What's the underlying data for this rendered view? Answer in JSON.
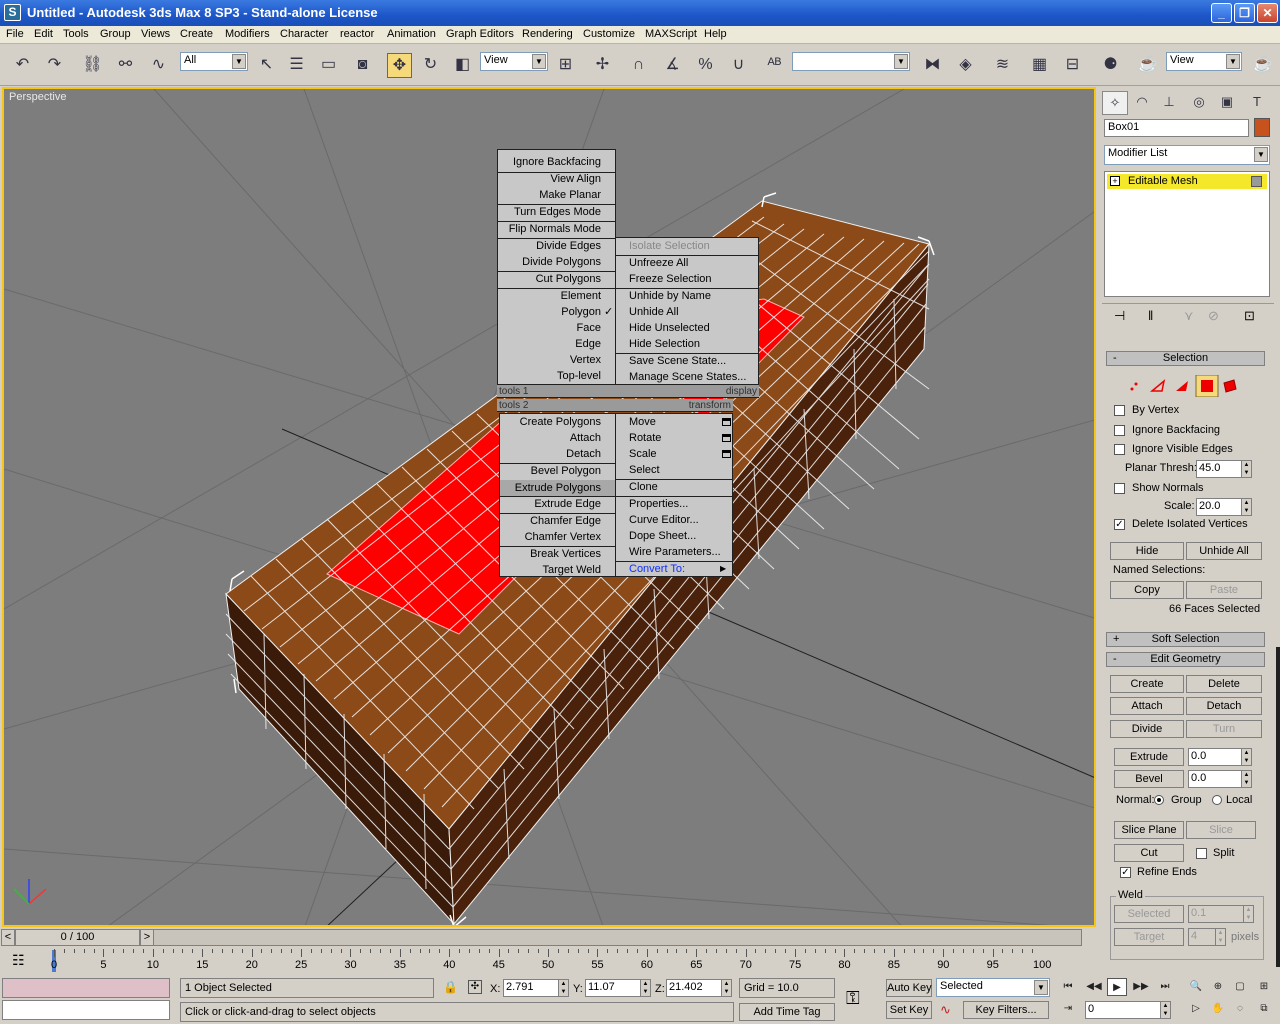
{
  "window": {
    "title": "Untitled - Autodesk 3ds Max 8 SP3   - Stand-alone License",
    "icon": "3ds-max-icon",
    "min": "_",
    "max": "❐",
    "close": "✕"
  },
  "menu": [
    "File",
    "Edit",
    "Tools",
    "Group",
    "Views",
    "Create",
    "Modifiers",
    "Character",
    "reactor",
    "Animation",
    "Graph Editors",
    "Rendering",
    "Customize",
    "MAXScript",
    "Help"
  ],
  "toolbar": {
    "selection_filter": "All",
    "ref_coord_left": "View",
    "named_selection": "",
    "ref_coord_right": "View"
  },
  "viewport": {
    "label": "Perspective"
  },
  "quad": {
    "tools1_header": "tools 1",
    "display_header": "display",
    "tools2_header": "tools 2",
    "transform_header": "transform",
    "tools1": [
      "Ignore Backfacing",
      "View Align",
      "Make Planar",
      "Turn Edges Mode",
      "Flip Normals Mode",
      "Divide Edges",
      "Divide Polygons",
      "Cut Polygons",
      "Element",
      "Polygon",
      "Face",
      "Edge",
      "Vertex",
      "Top-level"
    ],
    "display": [
      "Isolate Selection",
      "Unfreeze All",
      "Freeze Selection",
      "Unhide by Name",
      "Unhide All",
      "Hide Unselected",
      "Hide Selection",
      "Save Scene State...",
      "Manage Scene States..."
    ],
    "tools2": [
      "Create Polygons",
      "Attach",
      "Detach",
      "Bevel Polygon",
      "Extrude Polygons",
      "Extrude Edge",
      "Chamfer Edge",
      "Chamfer Vertex",
      "Break Vertices",
      "Target Weld"
    ],
    "transform": [
      "Move",
      "Rotate",
      "Scale",
      "Select",
      "Clone",
      "Properties...",
      "Curve Editor...",
      "Dope Sheet...",
      "Wire Parameters...",
      "Convert To:"
    ],
    "checkmark": "✓",
    "submenu_arrow": "▶"
  },
  "panel": {
    "object_name": "Box01",
    "object_color": "#c8521e",
    "modifier_list": "Modifier List",
    "stack_item": "Editable Mesh",
    "selection": {
      "title": "Selection",
      "by_vertex": "By Vertex",
      "ignore_backfacing": "Ignore Backfacing",
      "ignore_visible_edges": "Ignore Visible Edges",
      "planar_thresh_label": "Planar Thresh:",
      "planar_thresh": "45.0",
      "show_normals": "Show Normals",
      "scale_label": "Scale:",
      "scale": "20.0",
      "delete_isolated": "Delete Isolated Vertices",
      "hide": "Hide",
      "unhide_all": "Unhide All",
      "named_selections": "Named Selections:",
      "copy": "Copy",
      "paste": "Paste",
      "faces_selected": "66 Faces Selected"
    },
    "soft_selection": "Soft Selection",
    "edit_geometry": {
      "title": "Edit Geometry",
      "create": "Create",
      "delete": "Delete",
      "attach": "Attach",
      "detach": "Detach",
      "divide": "Divide",
      "turn": "Turn",
      "extrude": "Extrude",
      "extrude_val": "0.0",
      "bevel": "Bevel",
      "bevel_val": "0.0",
      "normal": "Normal:",
      "group": "Group",
      "local": "Local",
      "slice_plane": "Slice Plane",
      "slice": "Slice",
      "cut": "Cut",
      "split": "Split",
      "refine_ends": "Refine Ends",
      "weld": "Weld",
      "weld_selected": "Selected",
      "weld_selected_val": "0.1",
      "weld_target": "Target",
      "weld_target_val": "4",
      "pixels": "pixels"
    }
  },
  "timeline": {
    "slider": "0 / 100",
    "ticks": [
      "0",
      "5",
      "10",
      "15",
      "20",
      "25",
      "30",
      "35",
      "40",
      "45",
      "50",
      "55",
      "60",
      "65",
      "70",
      "75",
      "80",
      "85",
      "90",
      "95",
      "100"
    ]
  },
  "status": {
    "selected": "1 Object Selected",
    "prompt": "Click or click-and-drag to select objects",
    "x_label": "X:",
    "x": "2.791",
    "y_label": "Y:",
    "y": "11.07",
    "z_label": "Z:",
    "z": "21.402",
    "grid": "Grid = 10.0",
    "add_time_tag": "Add Time Tag",
    "auto_key": "Auto Key",
    "set_key": "Set Key",
    "key_mode": "Selected",
    "key_filters": "Key Filters...",
    "frame": "0"
  }
}
